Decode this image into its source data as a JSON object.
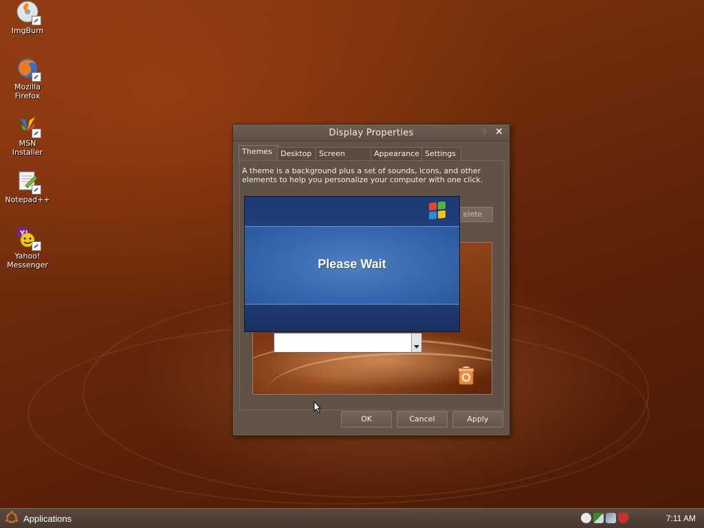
{
  "desktop": {
    "icons": [
      {
        "label": "ImgBurn"
      },
      {
        "label": "Mozilla\nFirefox"
      },
      {
        "label": "MSN\nInstaller"
      },
      {
        "label": "Notepad++"
      },
      {
        "label": "Yahoo!\nMessenger"
      }
    ]
  },
  "dialog": {
    "title": "Display Properties",
    "help_glyph": "?",
    "close_glyph": "✕",
    "tabs": [
      {
        "label": "Themes",
        "active": true
      },
      {
        "label": "Desktop",
        "active": false
      },
      {
        "label": "Screen Saver",
        "active": false
      },
      {
        "label": "Appearance",
        "active": false
      },
      {
        "label": "Settings",
        "active": false
      }
    ],
    "description": "A theme is a background plus a set of sounds, icons, and other elements to help you personalize your computer with one click.",
    "delete_label": "elete",
    "buttons": {
      "ok": "OK",
      "cancel": "Cancel",
      "apply": "Apply"
    }
  },
  "overlay": {
    "message": "Please Wait"
  },
  "taskbar": {
    "applications_label": "Applications",
    "clock": "7:11 AM"
  },
  "colors": {
    "desktop_brown": "#6c2a0b",
    "dialog_body": "#645448",
    "wait_blue": "#3667ad",
    "taskbar": "#4f4036"
  }
}
